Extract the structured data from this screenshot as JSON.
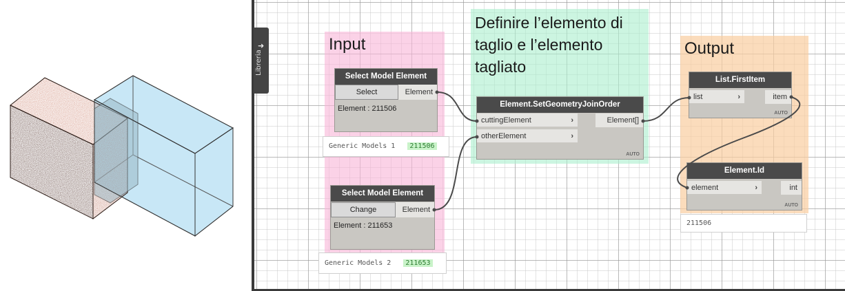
{
  "library_tab": {
    "label": "Libreria",
    "arrow": "➜"
  },
  "groups": {
    "input": {
      "title": "Input",
      "color": "#f8b4d7"
    },
    "define": {
      "title": "Definire l’elemento di taglio e l’elemento tagliato",
      "color": "#aaeecd"
    },
    "output": {
      "title": "Output",
      "color": "#facda0"
    }
  },
  "nodes": {
    "select1": {
      "title": "Select Model Element",
      "button": "Select",
      "output": "Element",
      "value": "Element : 211506",
      "watch_label": "Generic Models 1",
      "watch_id": "211506"
    },
    "select2": {
      "title": "Select Model Element",
      "button": "Change",
      "output": "Element",
      "value": "Element : 211653",
      "watch_label": "Generic Models 2",
      "watch_id": "211653"
    },
    "join_order": {
      "title": "Element.SetGeometryJoinOrder",
      "inputs": [
        "cuttingElement",
        "otherElement"
      ],
      "output": "Element[]",
      "lacing": "AUTO"
    },
    "first_item": {
      "title": "List.FirstItem",
      "input": "list",
      "output": "item",
      "lacing": "AUTO"
    },
    "element_id": {
      "title": "Element.Id",
      "input": "element",
      "output": "int",
      "lacing": "AUTO",
      "watch_value": "211506"
    }
  },
  "colors": {
    "node_header": "#4a4a4a",
    "wire": "#4a4a4a",
    "box_brick": "#c97a64",
    "box_glass": "#bfe3f5"
  }
}
